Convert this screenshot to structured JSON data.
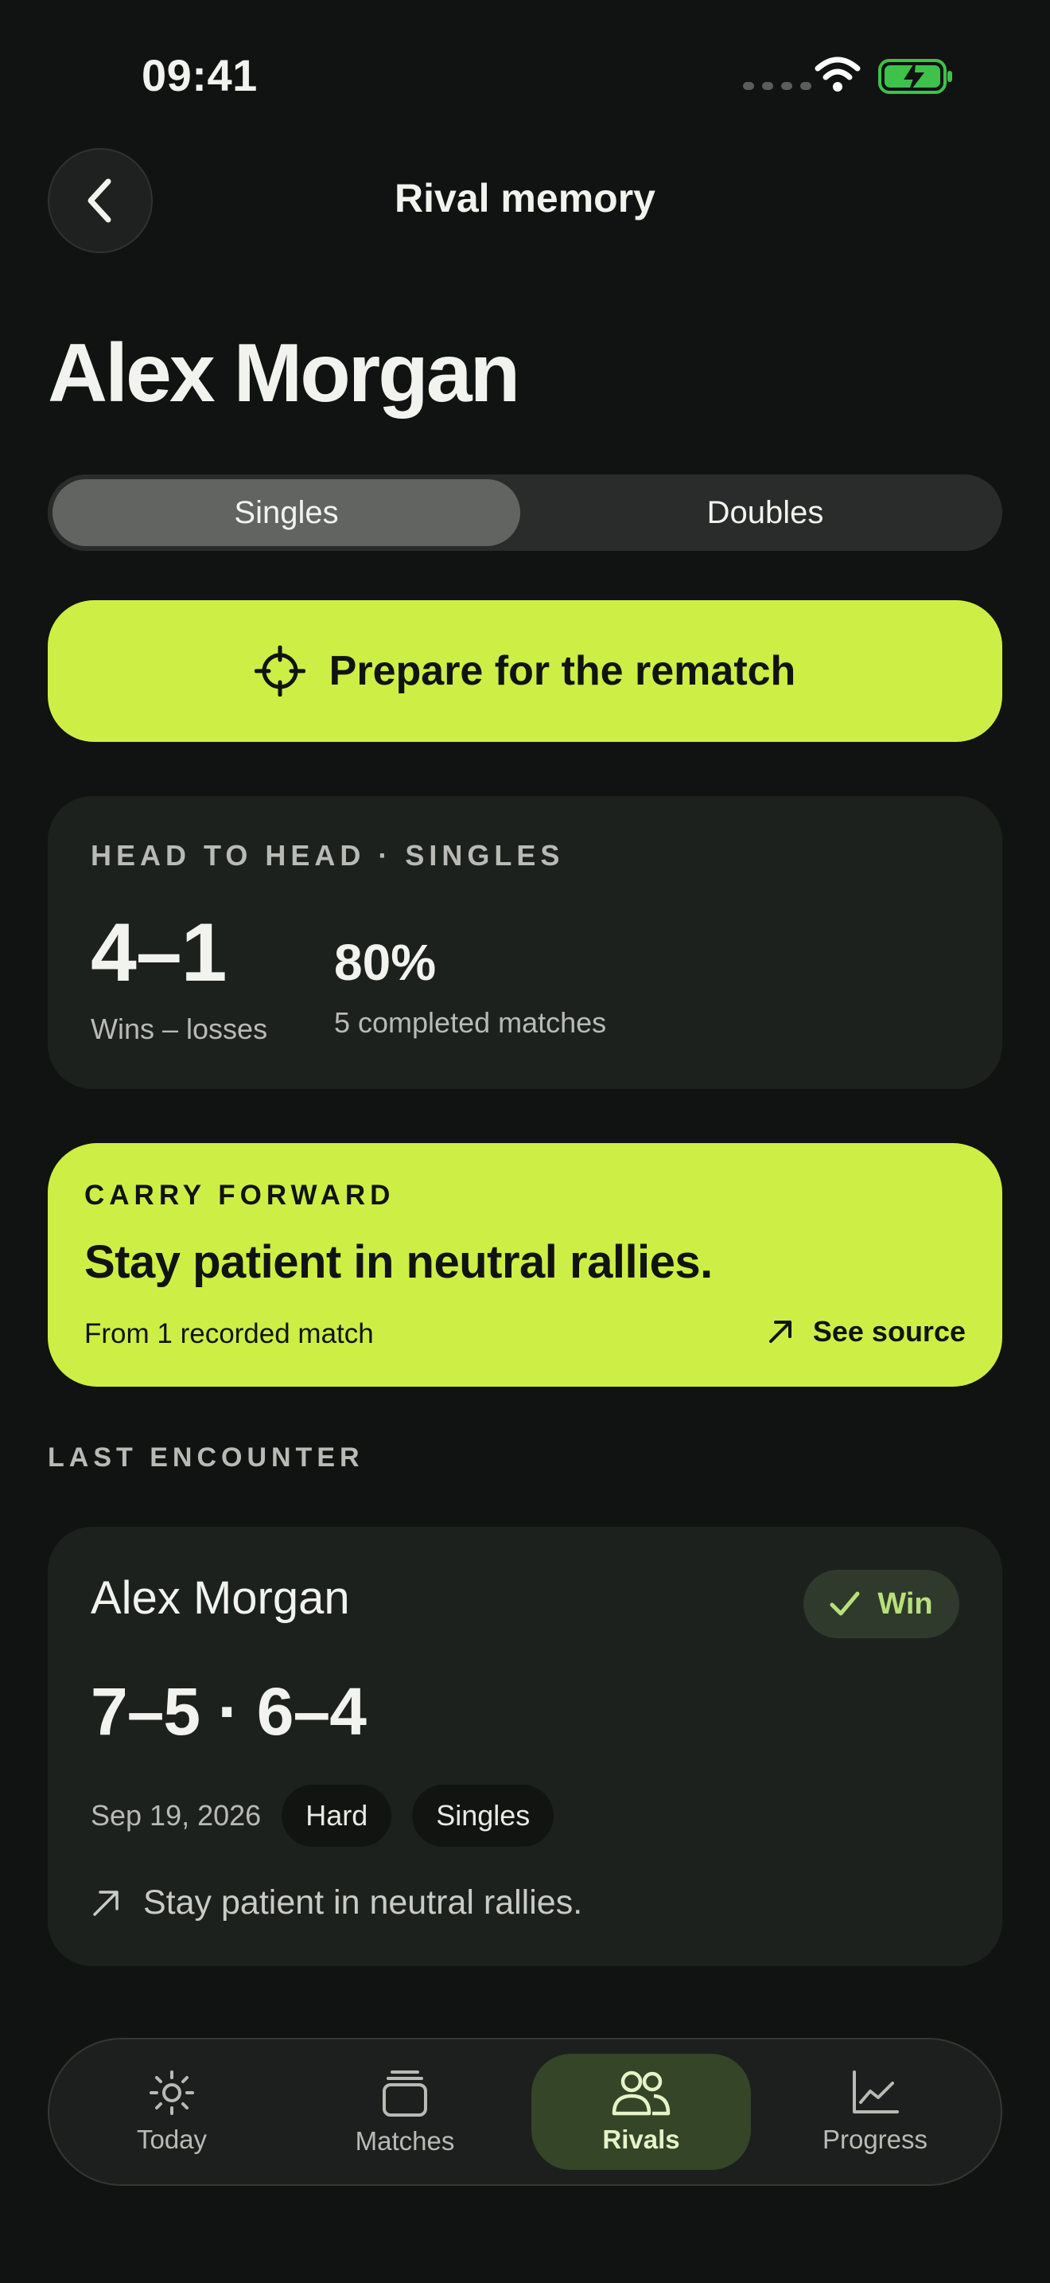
{
  "status_bar": {
    "time": "09:41"
  },
  "header": {
    "title": "Rival memory"
  },
  "rival": {
    "name": "Alex Morgan"
  },
  "segmented": {
    "options": [
      "Singles",
      "Doubles"
    ],
    "selected": "Singles"
  },
  "cta": {
    "label": "Prepare for the rematch",
    "icon": "crosshair-icon"
  },
  "head_to_head": {
    "eyebrow": "HEAD TO HEAD · SINGLES",
    "record": "4–1",
    "record_label": "Wins – losses",
    "win_pct": "80%",
    "win_pct_label": "5 completed matches"
  },
  "carry_forward": {
    "eyebrow": "CARRY FORWARD",
    "title": "Stay patient in neutral rallies.",
    "source": "From 1 recorded match",
    "link_label": "See source"
  },
  "last_encounter": {
    "section_label": "LAST ENCOUNTER",
    "opponent": "Alex Morgan",
    "result": "Win",
    "score": "7–5 · 6–4",
    "date": "Sep 19, 2026",
    "surface": "Hard",
    "format": "Singles",
    "note": "Stay patient in neutral rallies."
  },
  "tabs": [
    {
      "label": "Today",
      "icon": "sun-icon"
    },
    {
      "label": "Matches",
      "icon": "stack-icon"
    },
    {
      "label": "Rivals",
      "icon": "people-icon",
      "active": true
    },
    {
      "label": "Progress",
      "icon": "chart-icon"
    }
  ],
  "colors": {
    "accent": "#cdef45",
    "background": "#111312",
    "card": "#1d211e",
    "win": "#b8e07a"
  }
}
